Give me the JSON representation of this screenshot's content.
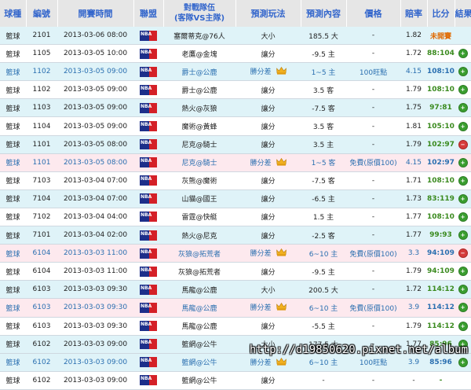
{
  "headers": [
    "球種",
    "編號",
    "開賽時間",
    "聯盟",
    "對戰隊伍\n(客隊VS主隊)",
    "預測玩法",
    "預測內容",
    "價格",
    "賠率",
    "比分",
    "結果"
  ],
  "league_badge": "NBA",
  "watermark": "http://d19850620.pixnet.net/album",
  "colors": {
    "header_text": "#3366cc",
    "row_alt": "#dff3f8",
    "row_pink": "#fde9ee",
    "win": "#3a9e2f",
    "lose": "#d63a3a",
    "score": "#3a8a1e",
    "pending": "#e06a00"
  },
  "rows": [
    {
      "sport": "籃球",
      "id": "2101",
      "time": "2013-03-06 08:00",
      "teams": "塞爾蒂克@76人",
      "play": "大小",
      "pick": "185.5 大",
      "price": "-",
      "odds": "1.82",
      "score": "未開賽",
      "result": "",
      "style": "odd",
      "crown": false,
      "blue": false
    },
    {
      "sport": "籃球",
      "id": "1105",
      "time": "2013-03-05 10:00",
      "teams": "老鷹@金塊",
      "play": "讓分",
      "pick": "-9.5 主",
      "price": "-",
      "odds": "1.72",
      "score": "88:104",
      "result": "win",
      "style": "even",
      "crown": false,
      "blue": false
    },
    {
      "sport": "籃球",
      "id": "1102",
      "time": "2013-03-05 09:00",
      "teams": "爵士@公鹿",
      "play": "勝分差",
      "pick": "1~5 主",
      "price": "100旺點",
      "odds": "4.15",
      "score": "108:109",
      "result": "win",
      "style": "odd",
      "crown": true,
      "blue": true
    },
    {
      "sport": "籃球",
      "id": "1102",
      "time": "2013-03-05 09:00",
      "teams": "爵士@公鹿",
      "play": "讓分",
      "pick": "3.5 客",
      "price": "-",
      "odds": "1.79",
      "score": "108:109",
      "result": "win",
      "style": "even",
      "crown": false,
      "blue": false
    },
    {
      "sport": "籃球",
      "id": "1103",
      "time": "2013-03-05 09:00",
      "teams": "熱火@灰狼",
      "play": "讓分",
      "pick": "-7.5 客",
      "price": "-",
      "odds": "1.75",
      "score": "97:81",
      "result": "win",
      "style": "odd",
      "crown": false,
      "blue": false
    },
    {
      "sport": "籃球",
      "id": "1104",
      "time": "2013-03-05 09:00",
      "teams": "魔術@黃蜂",
      "play": "讓分",
      "pick": "3.5 客",
      "price": "-",
      "odds": "1.81",
      "score": "105:102",
      "result": "win",
      "style": "even",
      "crown": false,
      "blue": false
    },
    {
      "sport": "籃球",
      "id": "1101",
      "time": "2013-03-05 08:00",
      "teams": "尼克@騎士",
      "play": "讓分",
      "pick": "3.5 主",
      "price": "-",
      "odds": "1.79",
      "score": "102:97",
      "result": "lose",
      "style": "odd",
      "crown": false,
      "blue": false
    },
    {
      "sport": "籃球",
      "id": "1101",
      "time": "2013-03-05 08:00",
      "teams": "尼克@騎士",
      "play": "勝分差",
      "pick": "1~5 客",
      "price": "免費(原價100)",
      "odds": "4.15",
      "score": "102:97",
      "result": "win",
      "style": "pink",
      "crown": true,
      "blue": true
    },
    {
      "sport": "籃球",
      "id": "7103",
      "time": "2013-03-04 07:00",
      "teams": "灰熊@魔術",
      "play": "讓分",
      "pick": "-7.5 客",
      "price": "-",
      "odds": "1.71",
      "score": "108:104",
      "result": "win",
      "style": "even",
      "crown": false,
      "blue": false
    },
    {
      "sport": "籃球",
      "id": "7104",
      "time": "2013-03-04 07:00",
      "teams": "山貓@國王",
      "play": "讓分",
      "pick": "-6.5 主",
      "price": "-",
      "odds": "1.73",
      "score": "83:119",
      "result": "win",
      "style": "odd",
      "crown": false,
      "blue": false
    },
    {
      "sport": "籃球",
      "id": "7102",
      "time": "2013-03-04 04:00",
      "teams": "雷霆@快艇",
      "play": "讓分",
      "pick": "1.5 主",
      "price": "-",
      "odds": "1.77",
      "score": "108:104",
      "result": "win",
      "style": "even",
      "crown": false,
      "blue": false
    },
    {
      "sport": "籃球",
      "id": "7101",
      "time": "2013-03-04 02:00",
      "teams": "熱火@尼克",
      "play": "讓分",
      "pick": "-2.5 客",
      "price": "-",
      "odds": "1.77",
      "score": "99:93",
      "result": "win",
      "style": "odd",
      "crown": false,
      "blue": false
    },
    {
      "sport": "籃球",
      "id": "6104",
      "time": "2013-03-03 11:00",
      "teams": "灰狼@拓荒者",
      "play": "勝分差",
      "pick": "6~10 主",
      "price": "免費(原價100)",
      "odds": "3.3",
      "score": "94:109",
      "result": "lose",
      "style": "pink",
      "crown": true,
      "blue": true
    },
    {
      "sport": "籃球",
      "id": "6104",
      "time": "2013-03-03 11:00",
      "teams": "灰狼@拓荒者",
      "play": "讓分",
      "pick": "-9.5 主",
      "price": "-",
      "odds": "1.79",
      "score": "94:109",
      "result": "win",
      "style": "even",
      "crown": false,
      "blue": false
    },
    {
      "sport": "籃球",
      "id": "6103",
      "time": "2013-03-03 09:30",
      "teams": "馬龍@公鹿",
      "play": "大小",
      "pick": "200.5 大",
      "price": "-",
      "odds": "1.72",
      "score": "114:122",
      "result": "win",
      "style": "odd",
      "crown": false,
      "blue": false
    },
    {
      "sport": "籃球",
      "id": "6103",
      "time": "2013-03-03 09:30",
      "teams": "馬龍@公鹿",
      "play": "勝分差",
      "pick": "6~10 主",
      "price": "免費(原價100)",
      "odds": "3.9",
      "score": "114:122",
      "result": "win",
      "style": "pink",
      "crown": true,
      "blue": true
    },
    {
      "sport": "籃球",
      "id": "6103",
      "time": "2013-03-03 09:30",
      "teams": "馬龍@公鹿",
      "play": "讓分",
      "pick": "-5.5 主",
      "price": "-",
      "odds": "1.79",
      "score": "114:122",
      "result": "win",
      "style": "even",
      "crown": false,
      "blue": false
    },
    {
      "sport": "籃球",
      "id": "6102",
      "time": "2013-03-03 09:00",
      "teams": "籃網@公牛",
      "play": "大小",
      "pick": "177.5 大",
      "price": "-",
      "odds": "1.77",
      "score": "85:96",
      "result": "win",
      "style": "odd",
      "crown": false,
      "blue": false
    },
    {
      "sport": "籃球",
      "id": "6102",
      "time": "2013-03-03 09:00",
      "teams": "籃網@公牛",
      "play": "勝分差",
      "pick": "6~10 主",
      "price": "100旺點",
      "odds": "3.9",
      "score": "85:96",
      "result": "win",
      "style": "odd",
      "crown": true,
      "blue": true
    },
    {
      "sport": "籃球",
      "id": "6102",
      "time": "2013-03-03 09:00",
      "teams": "籃網@公牛",
      "play": "讓分",
      "pick": "-",
      "price": "-",
      "odds": "-",
      "score": "-",
      "result": "",
      "style": "even",
      "crown": false,
      "blue": false
    }
  ]
}
